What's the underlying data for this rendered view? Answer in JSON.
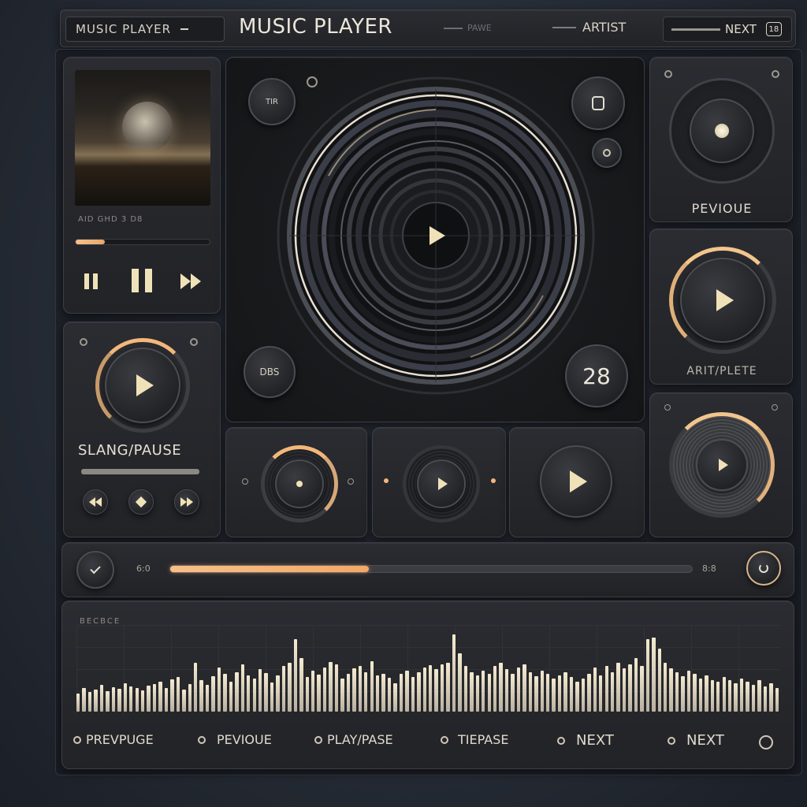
{
  "header": {
    "app_label": "MUSIC PLAYER",
    "title": "MUSIC PLAYER",
    "tab_blurred": "PAWE",
    "artist_label": "ARTIST",
    "next_label": "NEXT",
    "badge": "18"
  },
  "left_panel": {
    "track_text": "AID GHD 3 D8",
    "progress": 0.22
  },
  "left_play_panel": {
    "label": "SLANG/PAUSE"
  },
  "center": {
    "left_top_button": "TIR",
    "left_bottom_button": "DBS",
    "track_number": "28"
  },
  "right_column": {
    "card1_label": "PEVIOUE",
    "card2_label": "ARIT/PLETE"
  },
  "seek": {
    "start_time": "6:0",
    "end_time": "8:8",
    "progress": 0.38
  },
  "visualizer": {
    "header_text": "BECBCE",
    "levels": [
      0.23,
      0.3,
      0.25,
      0.28,
      0.34,
      0.26,
      0.31,
      0.29,
      0.36,
      0.32,
      0.3,
      0.27,
      0.33,
      0.35,
      0.38,
      0.3,
      0.41,
      0.44,
      0.28,
      0.35,
      0.62,
      0.4,
      0.34,
      0.45,
      0.56,
      0.48,
      0.38,
      0.5,
      0.6,
      0.46,
      0.42,
      0.54,
      0.49,
      0.37,
      0.46,
      0.58,
      0.62,
      0.92,
      0.68,
      0.44,
      0.52,
      0.47,
      0.56,
      0.63,
      0.6,
      0.42,
      0.48,
      0.55,
      0.58,
      0.5,
      0.64,
      0.46,
      0.48,
      0.43,
      0.36,
      0.48,
      0.52,
      0.44,
      0.5,
      0.56,
      0.59,
      0.54,
      0.6,
      0.62,
      0.98,
      0.74,
      0.58,
      0.5,
      0.46,
      0.52,
      0.48,
      0.58,
      0.62,
      0.54,
      0.48,
      0.56,
      0.6,
      0.5,
      0.45,
      0.52,
      0.48,
      0.42,
      0.46,
      0.5,
      0.44,
      0.38,
      0.42,
      0.48,
      0.56,
      0.46,
      0.58,
      0.5,
      0.62,
      0.55,
      0.6,
      0.68,
      0.58,
      0.92,
      0.94,
      0.8,
      0.62,
      0.55,
      0.5,
      0.45,
      0.52,
      0.48,
      0.42,
      0.46,
      0.4,
      0.38,
      0.44,
      0.4,
      0.36,
      0.42,
      0.38,
      0.34,
      0.4,
      0.32,
      0.36,
      0.3
    ],
    "controls": [
      "PREVPUGE",
      "PEVIOUE",
      "PLAY/PASE",
      "TIEPASE",
      "NEXT",
      "NEXT"
    ]
  },
  "colors": {
    "accent": "#f2b77a",
    "cream": "#f0e2b8",
    "panel": "#26272b"
  }
}
